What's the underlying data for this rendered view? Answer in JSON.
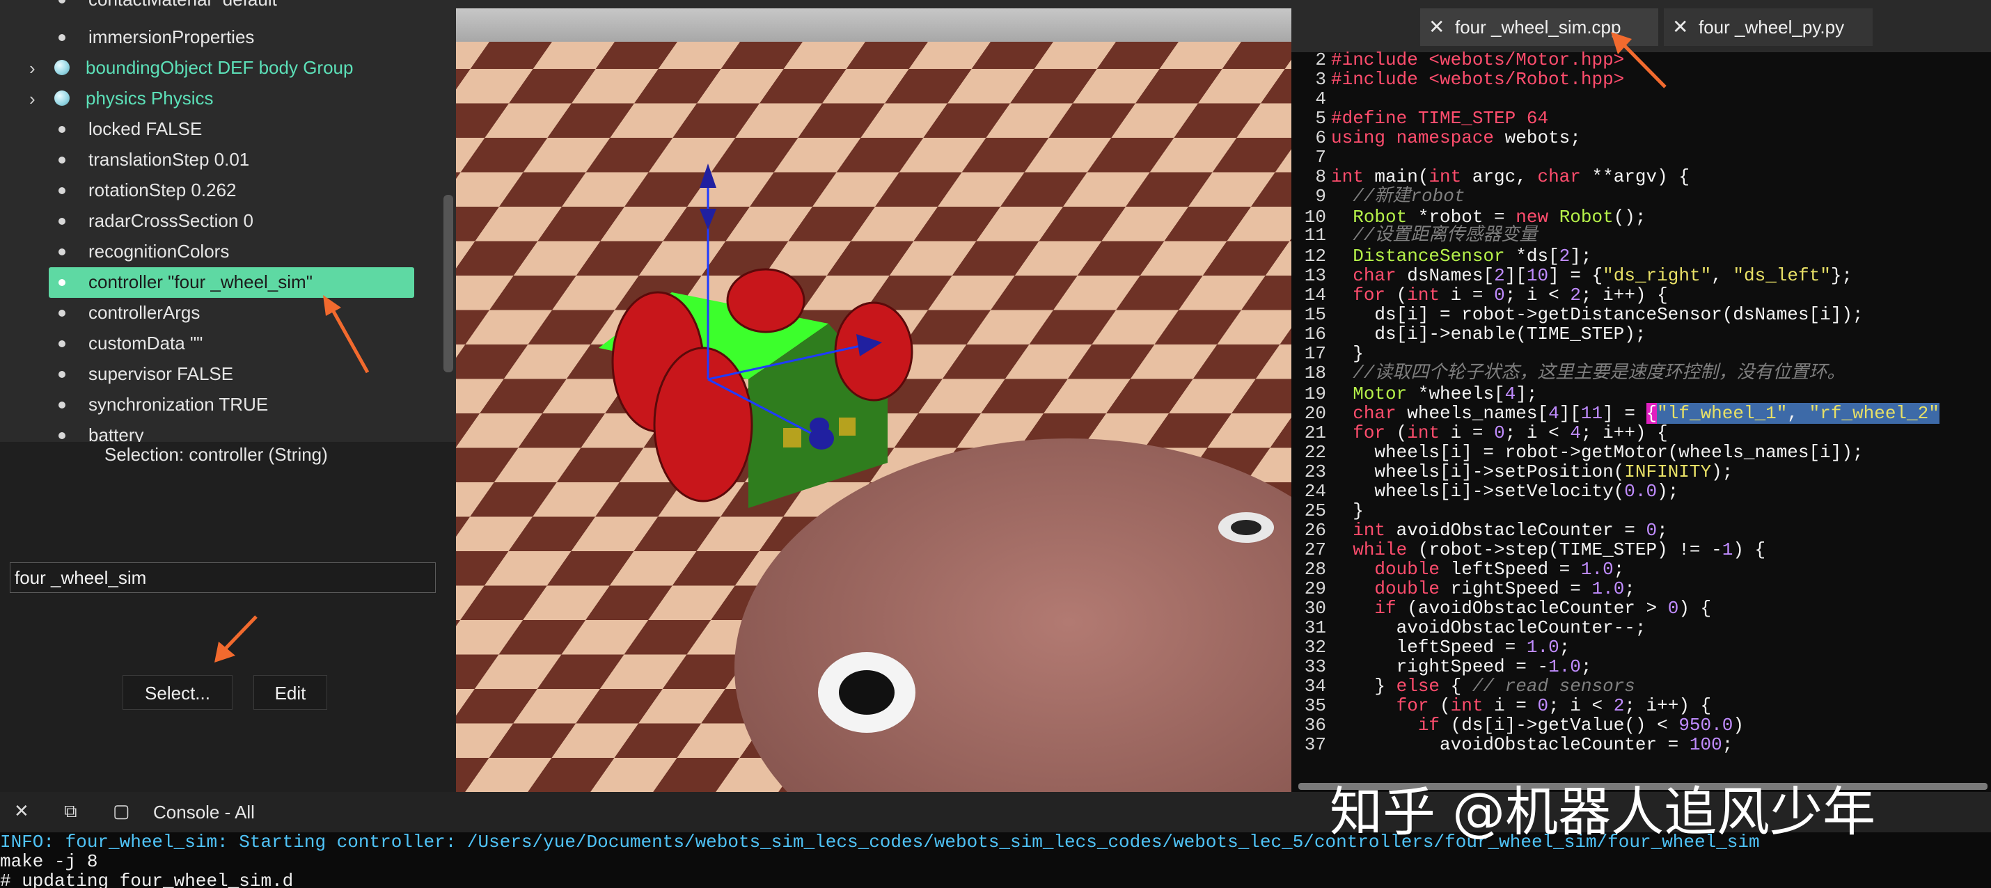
{
  "scene_tree": {
    "items": [
      {
        "label": "contactMaterial \"default\"",
        "kind": "field"
      },
      {
        "label": "immersionProperties",
        "kind": "field"
      },
      {
        "label": "boundingObject DEF body Group",
        "kind": "node"
      },
      {
        "label": "physics Physics",
        "kind": "node"
      },
      {
        "label": "locked FALSE",
        "kind": "field"
      },
      {
        "label": "translationStep 0.01",
        "kind": "field"
      },
      {
        "label": "rotationStep 0.262",
        "kind": "field"
      },
      {
        "label": "radarCrossSection 0",
        "kind": "field"
      },
      {
        "label": "recognitionColors",
        "kind": "field"
      },
      {
        "label": "controller \"four _wheel_sim\"",
        "kind": "field",
        "selected": true
      },
      {
        "label": "controllerArgs",
        "kind": "field"
      },
      {
        "label": "customData \"\"",
        "kind": "field"
      },
      {
        "label": "supervisor FALSE",
        "kind": "field"
      },
      {
        "label": "synchronization TRUE",
        "kind": "field"
      },
      {
        "label": "battery",
        "kind": "field"
      }
    ],
    "selection_text": "Selection: controller (String)",
    "field_value": "four _wheel_sim",
    "select_label": "Select...",
    "edit_label": "Edit"
  },
  "editor": {
    "tabs": [
      {
        "name": "four _wheel_sim.cpp",
        "active": true
      },
      {
        "name": "four _wheel_py.py",
        "active": false
      }
    ],
    "close_glyph": "✕",
    "line_numbers": [
      "2",
      "3",
      "4",
      "5",
      "6",
      "7",
      "8",
      "9",
      "10",
      "11",
      "12",
      "13",
      "14",
      "15",
      "16",
      "17",
      "18",
      "19",
      "20",
      "21",
      "22",
      "23",
      "24",
      "25",
      "26",
      "27",
      "28",
      "29",
      "30",
      "31",
      "32",
      "33",
      "34",
      "35",
      "36",
      "37"
    ]
  },
  "console": {
    "title": "Console - All",
    "lines": [
      "INFO: four_wheel_sim: Starting controller: /Users/yue/Documents/webots_sim_lecs_codes/webots_sim_lecs_codes/webots_lec_5/controllers/four_wheel_sim/four_wheel_sim",
      "make -j 8",
      "# updating four_wheel_sim.d"
    ]
  },
  "watermark": "知乎 @机器人追风少年",
  "colors": {
    "selection": "#5ed9a3",
    "node_label": "#5ce0b8",
    "keyword": "#ff4d6d",
    "class": "#b6f24a",
    "string": "#e8e066",
    "number": "#c08cff",
    "info": "#4fc3f7",
    "annotation_arrow": "#f26a2e"
  }
}
